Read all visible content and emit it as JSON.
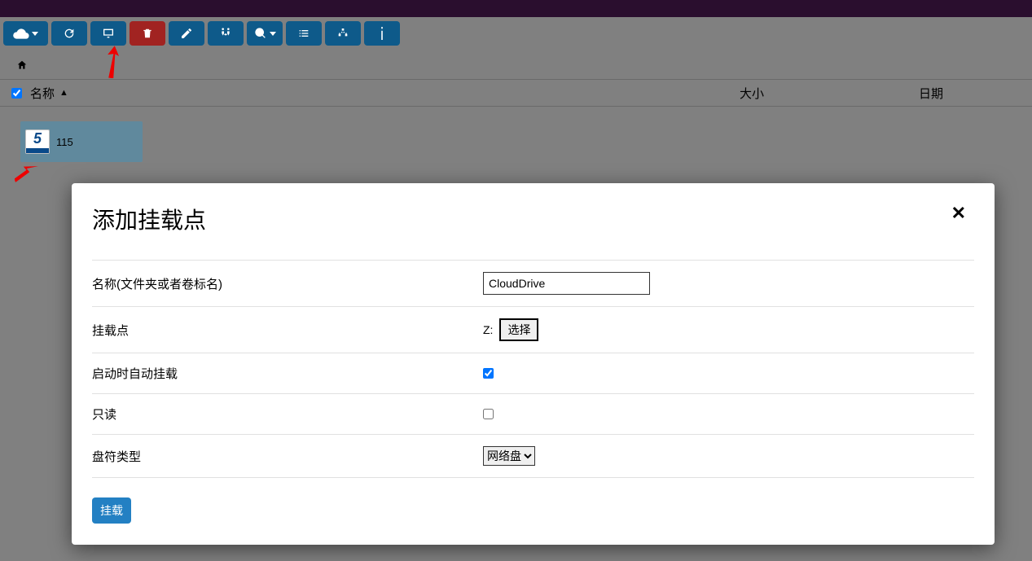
{
  "columns": {
    "name": "名称",
    "size": "大小",
    "date": "日期"
  },
  "file": {
    "label": "115"
  },
  "modal": {
    "title": "添加挂载点",
    "close": "✕",
    "fields": {
      "name_label": "名称(文件夹或者卷标名)",
      "name_value": "CloudDrive",
      "mount_label": "挂载点",
      "mount_drive": "Z:",
      "mount_select_btn": "选择",
      "automount_label": "启动时自动挂载",
      "automount_checked": true,
      "readonly_label": "只读",
      "readonly_checked": false,
      "drivetype_label": "盘符类型",
      "drivetype_value": "网络盘"
    },
    "submit": "挂载"
  }
}
